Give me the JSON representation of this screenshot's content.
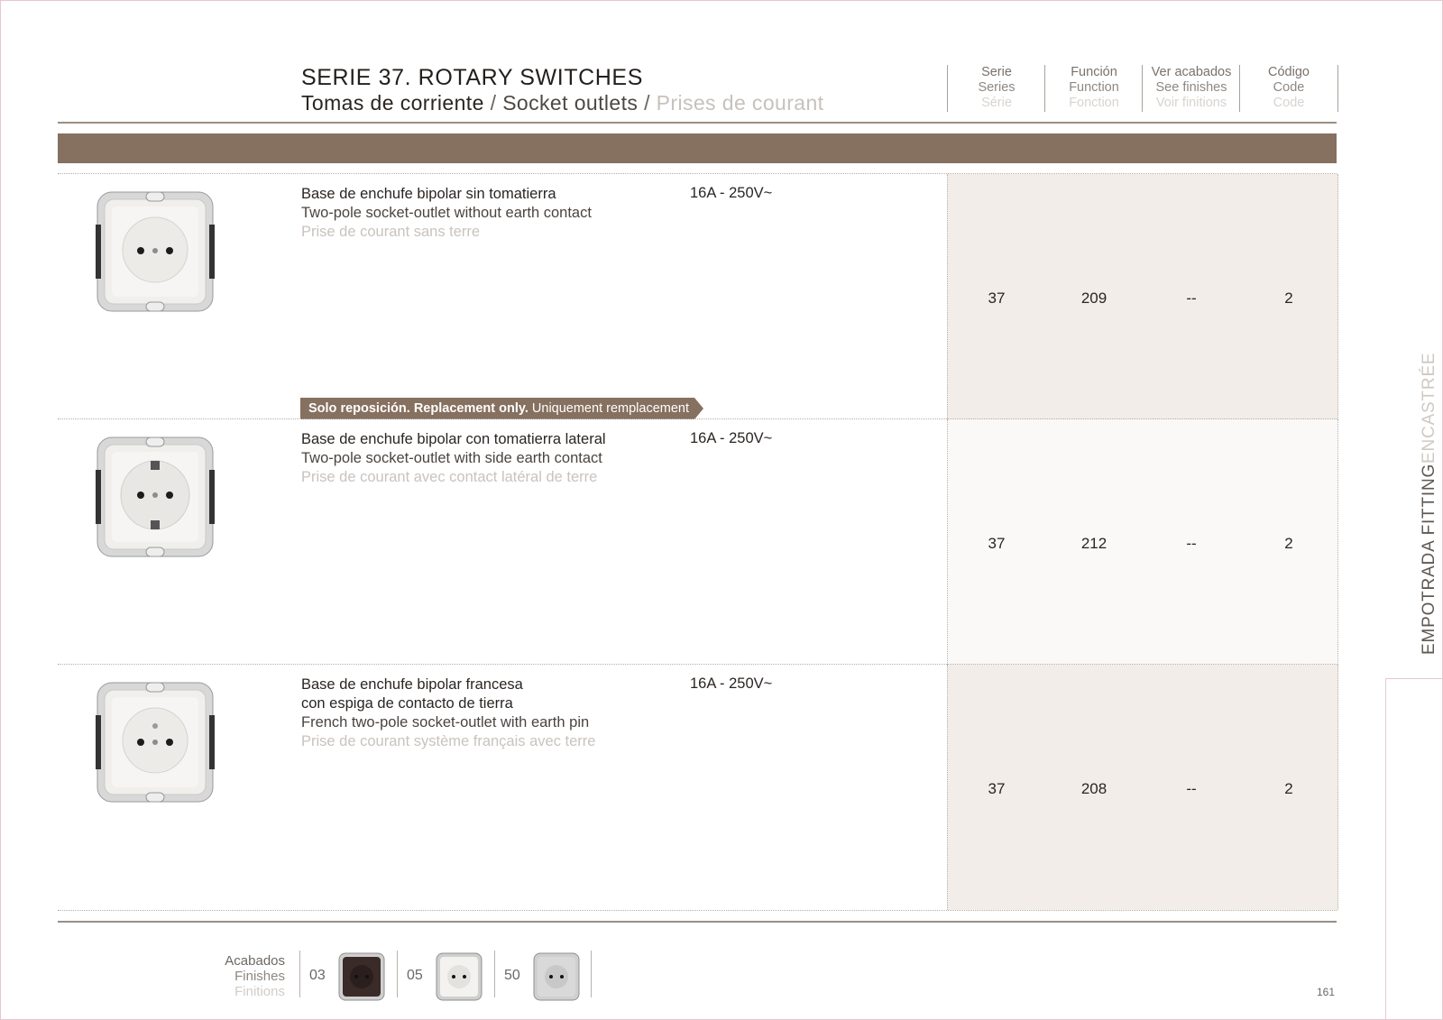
{
  "header": {
    "title": "SERIE 37. ROTARY SWITCHES",
    "subtitle_es": "Tomas de corriente",
    "subtitle_sep": "/",
    "subtitle_en": "Socket outlets",
    "subtitle_fr": "Prises de courant"
  },
  "columns": [
    {
      "es": "Serie",
      "en": "Series",
      "fr": "Série"
    },
    {
      "es": "Función",
      "en": "Function",
      "fr": "Fonction"
    },
    {
      "es": "Ver acabados",
      "en": "See finishes",
      "fr": "Voir finitions"
    },
    {
      "es": "Código",
      "en": "Code",
      "fr": "Code"
    }
  ],
  "products": [
    {
      "desc_es": "Base de enchufe bipolar sin tomatierra",
      "desc_en": "Two-pole socket-outlet without earth contact",
      "desc_fr": "Prise de courant sans terre",
      "rating": "16A - 250V~",
      "serie": "37",
      "function": "209",
      "finishes": "--",
      "code": "2",
      "badge": {
        "es": "Solo reposición.",
        "en": "Replacement only.",
        "fr": "Uniquement remplacement"
      }
    },
    {
      "desc_es": "Base de enchufe bipolar con tomatierra lateral",
      "desc_en": "Two-pole socket-outlet with side earth contact",
      "desc_fr": "Prise de courant avec contact latéral de terre",
      "rating": "16A - 250V~",
      "serie": "37",
      "function": "212",
      "finishes": "--",
      "code": "2"
    },
    {
      "desc_es": "Base de enchufe bipolar francesa",
      "desc_es2": "con espiga de contacto de tierra",
      "desc_en": "French two-pole socket-outlet with earth pin",
      "desc_fr": "Prise de courant système français avec terre",
      "rating": "16A - 250V~",
      "serie": "37",
      "function": "208",
      "finishes": "--",
      "code": "2"
    }
  ],
  "side_tab": {
    "a": "EMPOTRADA FITTING",
    "b": "ENCASTRÉE"
  },
  "finishes": {
    "label_es": "Acabados",
    "label_en": "Finishes",
    "label_fr": "Finitions",
    "items": [
      {
        "code": "03",
        "color": "#3a2a28"
      },
      {
        "code": "05",
        "color": "#f4f2ee"
      },
      {
        "code": "50",
        "color": "#d9d9d9"
      }
    ]
  },
  "page_number": "161",
  "colors": {
    "accent": "#86705f",
    "tint": "#f2ede8"
  }
}
